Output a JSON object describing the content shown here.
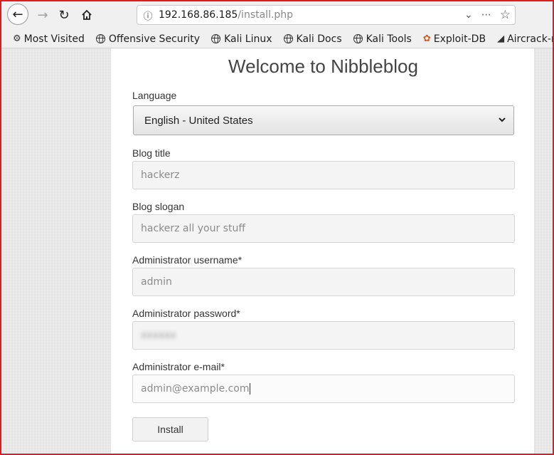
{
  "browser": {
    "url_host": "192.168.86.185",
    "url_path": "/install.php",
    "bookmarks": [
      {
        "label": "Most Visited",
        "icon": "gear-icon"
      },
      {
        "label": "Offensive Security",
        "icon": "globe-icon"
      },
      {
        "label": "Kali Linux",
        "icon": "globe-icon"
      },
      {
        "label": "Kali Docs",
        "icon": "globe-icon"
      },
      {
        "label": "Kali Tools",
        "icon": "globe-icon"
      },
      {
        "label": "Exploit-DB",
        "icon": "exploit-db-icon"
      },
      {
        "label": "Aircrack-ng",
        "icon": "aircrack-icon"
      }
    ]
  },
  "install_form": {
    "title": "Welcome to Nibbleblog",
    "language_label": "Language",
    "language_value": "English - United States",
    "blog_title_label": "Blog title",
    "blog_title_value": "hackerz",
    "blog_slogan_label": "Blog slogan",
    "blog_slogan_value": "hackerz all your stuff",
    "admin_username_label": "Administrator username*",
    "admin_username_value": "admin",
    "admin_password_label": "Administrator password*",
    "admin_password_value": "xxxxxx",
    "admin_email_label": "Administrator e-mail*",
    "admin_email_value": "admin@example.com",
    "install_label": "Install"
  },
  "colors": {
    "frame_border": "#e01b1b",
    "panel_bg": "#ffffff",
    "page_bg": "#ececec"
  }
}
